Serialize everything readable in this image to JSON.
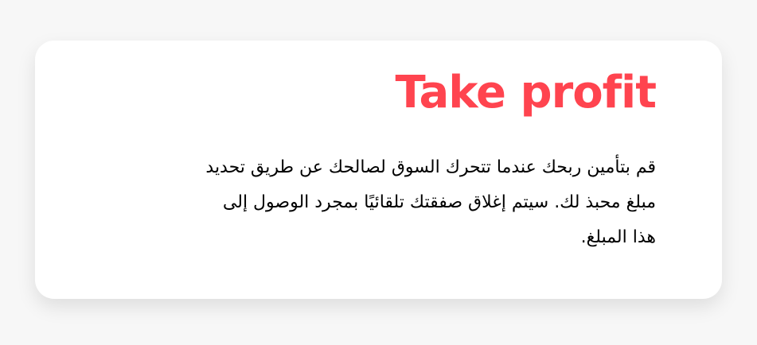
{
  "card": {
    "title": "Take profit",
    "description_lines": [
      "قم بتأمين ربحك عندما تتحرك السوق لصالحك عن طريق تحديد",
      "مبلغ محبذ لك. سيتم إغلاق صفقتك تلقائيًا بمجرد الوصول إلى",
      "هذا المبلغ."
    ]
  },
  "colors": {
    "accent": "#ff444f",
    "page_background": "#f7f7f7",
    "card_background": "#ffffff",
    "text": "#000000"
  }
}
